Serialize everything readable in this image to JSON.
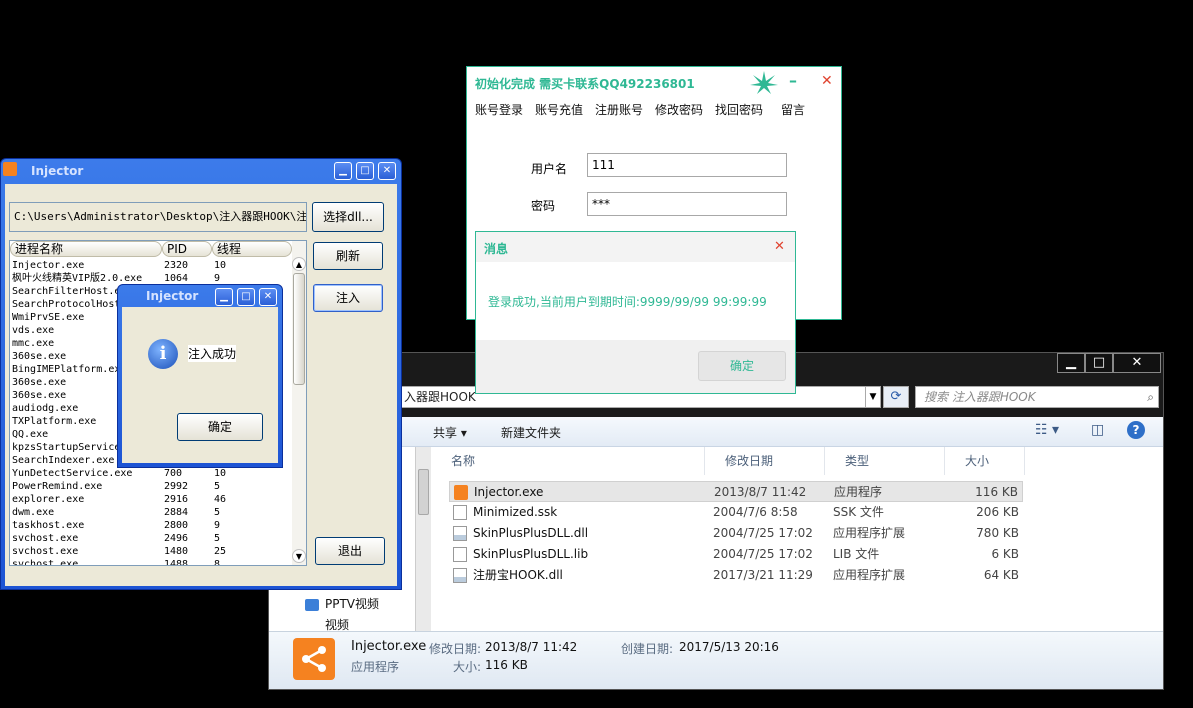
{
  "explorer": {
    "address": "入器跟HOOK",
    "search_placeholder": "搜索 注入器跟HOOK",
    "toolbar": {
      "share": "共享 ▾",
      "new_folder": "新建文件夹"
    },
    "nav": {
      "item1": "PPTV视频",
      "item2": "视频"
    },
    "columns": {
      "name": "名称",
      "date": "修改日期",
      "type": "类型",
      "size": "大小"
    },
    "files": [
      {
        "name": "Injector.exe",
        "date": "2013/8/7 11:42",
        "type": "应用程序",
        "size": "116 KB",
        "icon": "injector-app-icon"
      },
      {
        "name": "Minimized.ssk",
        "date": "2004/7/6 8:58",
        "type": "SSK 文件",
        "size": "206 KB",
        "icon": "file-icon"
      },
      {
        "name": "SkinPlusPlusDLL.dll",
        "date": "2004/7/25 17:02",
        "type": "应用程序扩展",
        "size": "780 KB",
        "icon": "dll-icon"
      },
      {
        "name": "SkinPlusPlusDLL.lib",
        "date": "2004/7/25 17:02",
        "type": "LIB 文件",
        "size": "6 KB",
        "icon": "file-icon"
      },
      {
        "name": "注册宝HOOK.dll",
        "date": "2017/3/21 11:29",
        "type": "应用程序扩展",
        "size": "64 KB",
        "icon": "dll-icon"
      }
    ],
    "status": {
      "name": "Injector.exe",
      "modified_label": "修改日期:",
      "modified": "2013/8/7 11:42",
      "created_label": "创建日期:",
      "created": "2017/5/13 20:16",
      "type": "应用程序",
      "size_label": "大小:",
      "size": "116 KB"
    }
  },
  "injector": {
    "title": "Injector",
    "dll_path": "C:\\Users\\Administrator\\Desktop\\注入器跟HOOK\\注册宝HOOK.dll",
    "buttons": {
      "select_dll": "选择dll...",
      "refresh": "刷新",
      "inject": "注入",
      "exit": "退出"
    },
    "columns": {
      "name": "进程名称",
      "pid": "PID",
      "threads": "线程"
    },
    "processes": [
      {
        "name": "Injector.exe",
        "pid": "2320",
        "threads": "10"
      },
      {
        "name": "枫叶火线精英VIP版2.0.exe",
        "pid": "1064",
        "threads": "9"
      },
      {
        "name": "SearchFilterHost.exe",
        "pid": "",
        "threads": ""
      },
      {
        "name": "SearchProtocolHost.exe",
        "pid": "",
        "threads": ""
      },
      {
        "name": "WmiPrvSE.exe",
        "pid": "",
        "threads": ""
      },
      {
        "name": "vds.exe",
        "pid": "",
        "threads": ""
      },
      {
        "name": "mmc.exe",
        "pid": "",
        "threads": ""
      },
      {
        "name": "360se.exe",
        "pid": "",
        "threads": ""
      },
      {
        "name": "BingIMEPlatform.exe",
        "pid": "",
        "threads": ""
      },
      {
        "name": "360se.exe",
        "pid": "",
        "threads": ""
      },
      {
        "name": "360se.exe",
        "pid": "",
        "threads": ""
      },
      {
        "name": "audiodg.exe",
        "pid": "",
        "threads": ""
      },
      {
        "name": "TXPlatform.exe",
        "pid": "",
        "threads": ""
      },
      {
        "name": "QQ.exe",
        "pid": "",
        "threads": ""
      },
      {
        "name": "kpzsStartupService",
        "pid": "",
        "threads": ""
      },
      {
        "name": "SearchIndexer.exe",
        "pid": "",
        "threads": ""
      },
      {
        "name": "YunDetectService.exe",
        "pid": "700",
        "threads": "10"
      },
      {
        "name": "PowerRemind.exe",
        "pid": "2992",
        "threads": "5"
      },
      {
        "name": "explorer.exe",
        "pid": "2916",
        "threads": "46"
      },
      {
        "name": "dwm.exe",
        "pid": "2884",
        "threads": "5"
      },
      {
        "name": "taskhost.exe",
        "pid": "2800",
        "threads": "9"
      },
      {
        "name": "svchost.exe",
        "pid": "2496",
        "threads": "5"
      },
      {
        "name": "svchost.exe",
        "pid": "1480",
        "threads": "25"
      },
      {
        "name": "svchost.exe",
        "pid": "1488",
        "threads": "8"
      }
    ]
  },
  "inject_msgbox": {
    "title": "Injector",
    "message": "注入成功",
    "ok": "确定"
  },
  "login": {
    "title": "初始化完成   需买卡联系QQ492236801",
    "menu": [
      "账号登录",
      "账号充值",
      "注册账号",
      "修改密码",
      "找回密码",
      "留言"
    ],
    "username_label": "用户名",
    "username_value": "111",
    "password_label": "密码",
    "password_value": "***",
    "accent": "#2fb894"
  },
  "message_dialog": {
    "title": "消息",
    "text": "登录成功,当前用户到期时间:9999/99/99 99:99:99",
    "ok": "确定"
  }
}
